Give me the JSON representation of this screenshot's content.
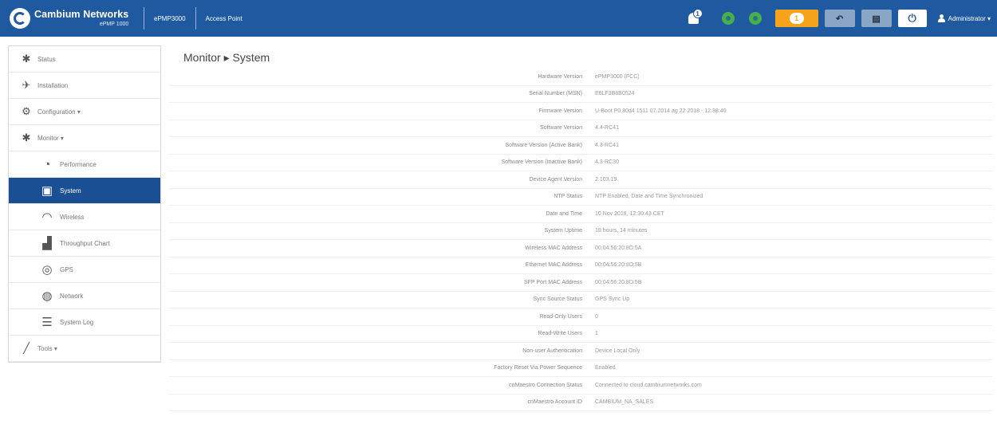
{
  "header": {
    "brand_name": "Cambium Networks",
    "brand_sub": "ePMP 1000",
    "device_model": "ePMP3000",
    "device_mode": "Access Point",
    "notification_count": "1",
    "alert_count": "1",
    "undo_label": "↶",
    "save_label": "▤",
    "power_label": "⏻",
    "user_label": "Administrator"
  },
  "sidebar": {
    "items": [
      {
        "label": "Status",
        "icon": "status-icon"
      },
      {
        "label": "Installation",
        "icon": "installation-icon"
      },
      {
        "label": "Configuration",
        "icon": "gear-icon"
      },
      {
        "label": "Monitor",
        "icon": "monitor-icon"
      },
      {
        "label": "Performance",
        "icon": "performance-icon"
      },
      {
        "label": "System",
        "icon": "system-icon"
      },
      {
        "label": "Wireless",
        "icon": "wifi-icon"
      },
      {
        "label": "Throughput Chart",
        "icon": "chart-icon"
      },
      {
        "label": "GPS",
        "icon": "gps-icon"
      },
      {
        "label": "Network",
        "icon": "globe-icon"
      },
      {
        "label": "System Log",
        "icon": "log-icon"
      },
      {
        "label": "Tools",
        "icon": "wrench-icon"
      }
    ]
  },
  "page_title": "Monitor ▸ System",
  "system_info": [
    {
      "label": "Hardware Version",
      "value": "ePMP3000 (FCC)"
    },
    {
      "label": "Serial Number (MSN)",
      "value": "E6LF3B8B0524"
    },
    {
      "label": "Firmware Version",
      "value": "U-Boot P0.80d4 1511 07.2014 ag 22 2018 - 12:38:40"
    },
    {
      "label": "Software Version",
      "value": "4.4-RC41"
    },
    {
      "label": "Software Version (Active Bank)",
      "value": "4.3-RC41"
    },
    {
      "label": "Software Version (Inactive Bank)",
      "value": "4.3-RC30"
    },
    {
      "label": "Device Agent Version",
      "value": "2.103.19"
    },
    {
      "label": "NTP Status",
      "value": "NTP Enabled, Date and Time Synchronized"
    },
    {
      "label": "Date and Time",
      "value": "10 Nov 2018, 12:30:43 CET"
    },
    {
      "label": "System Uptime",
      "value": "18 hours, 14 minutes"
    },
    {
      "label": "Wireless MAC Address",
      "value": "00:04:56:20:8D:5A"
    },
    {
      "label": "Ethernet MAC Address",
      "value": "00:04:56:20:8D:5B"
    },
    {
      "label": "SFP Port MAC Address",
      "value": "00:04:56:20:8D:5B"
    },
    {
      "label": "Sync Source Status",
      "value": "GPS Sync Up"
    },
    {
      "label": "Read-Only Users",
      "value": "0"
    },
    {
      "label": "Read-Write Users",
      "value": "1"
    },
    {
      "label": "Non-user Authentication",
      "value": "Device Local Only"
    },
    {
      "label": "Factory Reset Via Power Sequence",
      "value": "Enabled"
    },
    {
      "label": "cnMaestro Connection Status",
      "value": "Connected to cloud.cambiumnetworks.com"
    },
    {
      "label": "cnMaestro Account ID",
      "value": "CAMBIUM_NA_SALES"
    }
  ]
}
